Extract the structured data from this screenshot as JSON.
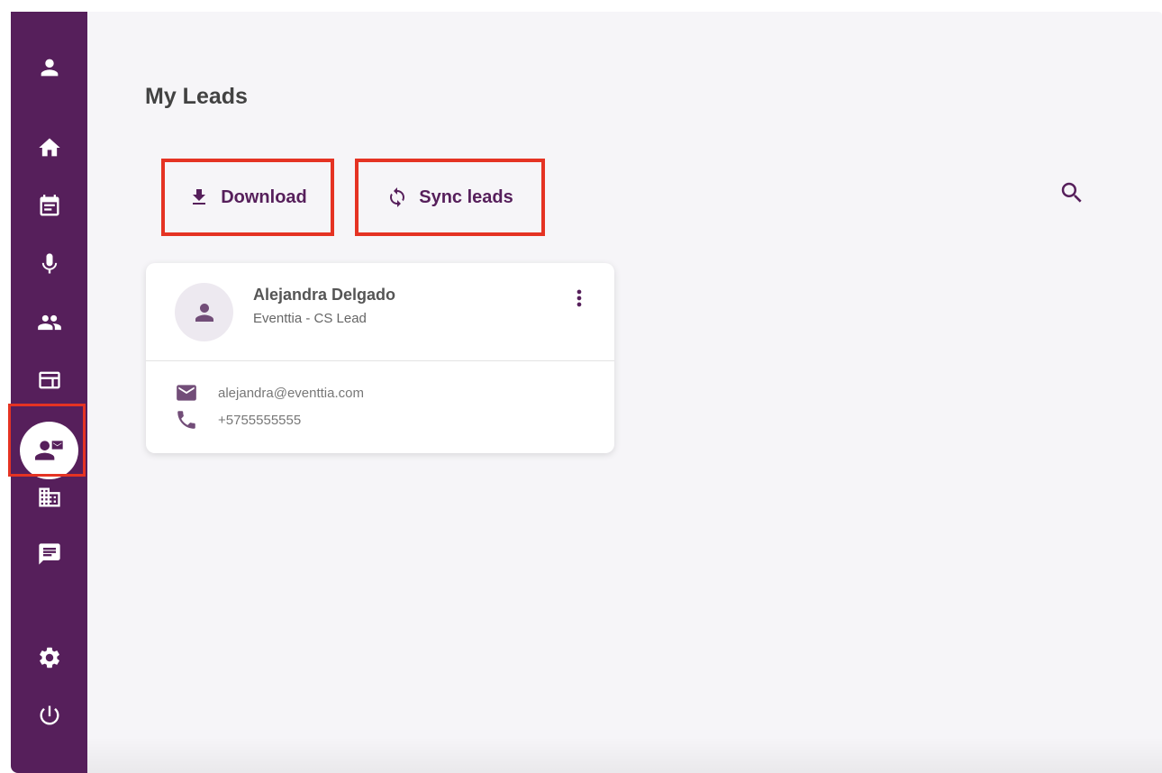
{
  "sidebar": {
    "items": [
      {
        "icon": "account-icon"
      },
      {
        "icon": "home-icon"
      },
      {
        "icon": "agenda-icon"
      },
      {
        "icon": "microphone-icon"
      },
      {
        "icon": "attendees-icon"
      },
      {
        "icon": "layout-icon"
      },
      {
        "icon": "leads-icon",
        "active": true
      },
      {
        "icon": "building-icon"
      },
      {
        "icon": "chat-icon"
      },
      {
        "icon": "settings-icon"
      },
      {
        "icon": "power-icon"
      }
    ],
    "background": "#561f5b"
  },
  "main": {
    "title": "My Leads",
    "actions": {
      "download_label": "Download",
      "sync_label": "Sync leads"
    }
  },
  "leads": [
    {
      "name": "Alejandra Delgado",
      "subtitle": "Eventtia - CS Lead",
      "email": "alejandra@eventtia.com",
      "phone": "+5755555555"
    }
  ],
  "colors": {
    "brand": "#561f5b",
    "highlight": "#e53323",
    "background": "#f6f5f8"
  }
}
